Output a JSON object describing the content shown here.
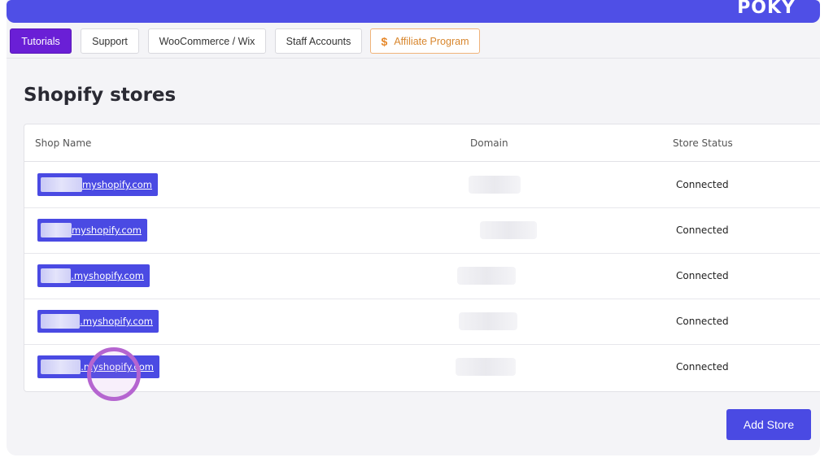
{
  "brand": "POKY",
  "nav": {
    "tutorials": "Tutorials",
    "support": "Support",
    "woocommerce": "WooCommerce / Wix",
    "staff": "Staff Accounts",
    "affiliate": "Affiliate Program",
    "affiliate_icon": "$"
  },
  "page": {
    "title": "Shopify stores"
  },
  "table": {
    "headers": {
      "shop_name": "Shop Name",
      "domain": "Domain",
      "status": "Store Status"
    },
    "rows": [
      {
        "shop_suffix": "myshopify.com",
        "status": "Connected"
      },
      {
        "shop_suffix": "myshopify.com",
        "status": "Connected"
      },
      {
        "shop_suffix": ".myshopify.com",
        "status": "Connected"
      },
      {
        "shop_suffix": ".myshopify.com",
        "status": "Connected"
      },
      {
        "shop_suffix": ".myshopify.com",
        "status": "Connected"
      }
    ]
  },
  "actions": {
    "add_store": "Add Store"
  },
  "colors": {
    "brand": "#4f4fe6",
    "active_tab": "#6a1fd6",
    "affiliate": "#e6882a",
    "cursor_ring": "#b565d0"
  }
}
